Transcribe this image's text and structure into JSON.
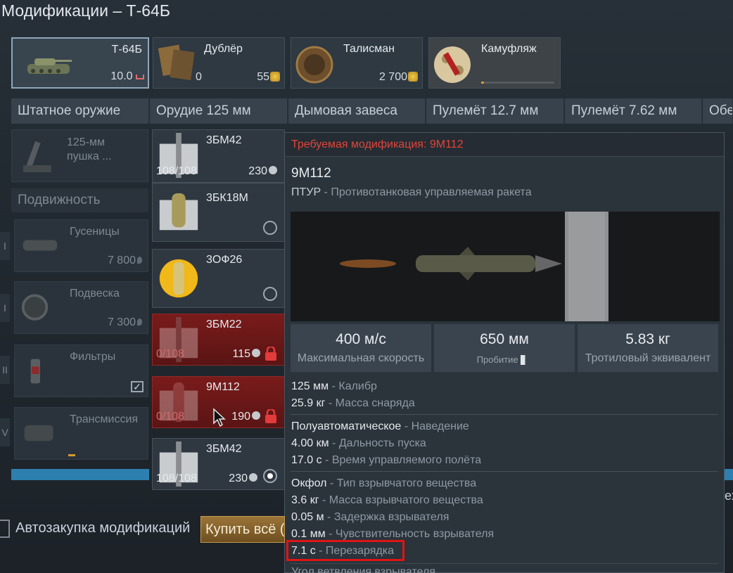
{
  "window": {
    "title": "Модификации – Т-64Б"
  },
  "slots": [
    {
      "name": "Т-64Б",
      "value": "10.0"
    },
    {
      "name": "Дублёр",
      "left_value": "0",
      "value": "55"
    },
    {
      "name": "Талисман",
      "value": "2 700"
    },
    {
      "name": "Камуфляж"
    }
  ],
  "tabs": [
    "Штатное оружие",
    "Орудие 125 мм",
    "Дымовая завеса",
    "Пулемёт 12.7 мм",
    "Пулемёт 7.62 мм",
    "Обе"
  ],
  "left_mods": {
    "gun_label": "125-мм пушка ...",
    "section": "Подвижность",
    "items": [
      {
        "label": "Гусеницы",
        "price": "7 800"
      },
      {
        "label": "Подвеска",
        "price": "7 300"
      },
      {
        "label": "Фильтры",
        "price": ""
      },
      {
        "label": "Трансмиссия",
        "price": ""
      }
    ],
    "roman": [
      "I",
      "I",
      "II",
      "V"
    ]
  },
  "ammo": [
    {
      "name": "3БМ42",
      "count": "108/108",
      "cost": "230"
    },
    {
      "name": "3БК18М"
    },
    {
      "name": "3ОФ26"
    },
    {
      "name": "3БМ22",
      "count": "0/108",
      "cost": "115"
    },
    {
      "name": "9М112",
      "count": "0/108",
      "cost": "190"
    },
    {
      "name": "3БМ42",
      "count": "108/108",
      "cost": "230"
    }
  ],
  "tooltip": {
    "required": "Требуемая модификация: 9М112",
    "title": "9М112",
    "subtitle_type": "ПТУР",
    "subtitle_desc": "Противотанковая управляемая ракета",
    "stats": [
      {
        "value": "400 м/с",
        "label": "Максимальная скорость"
      },
      {
        "value": "650 мм",
        "label": "Пробитие"
      },
      {
        "value": "5.83 кг",
        "label": "Тротиловый эквивалент"
      }
    ],
    "group1": [
      {
        "value": "125 мм",
        "label": "Калибр"
      },
      {
        "value": "25.9 кг",
        "label": "Масса снаряда"
      }
    ],
    "group2": [
      {
        "value": "Полуавтоматическое",
        "label": "Наведение"
      },
      {
        "value": "4.00 км",
        "label": "Дальность пуска"
      },
      {
        "value": "17.0 с",
        "label": "Время управляемого полёта"
      }
    ],
    "group3": [
      {
        "value": "Окфол",
        "label": "Тип взрывчатого вещества"
      },
      {
        "value": "3.6 кг",
        "label": "Масса взрывчатого вещества"
      },
      {
        "value": "0.05 м",
        "label": "Задержка взрывателя"
      },
      {
        "value": "0.1 мм",
        "label": "Чувствительность взрывателя"
      },
      {
        "value": "7.1 с",
        "label": "Перезарядка"
      }
    ],
    "cut_line": "Угол ветвления взрывателя..."
  },
  "bottom": {
    "auto_label": "Автозакупка модификаций",
    "buy_all": "Купить всё (",
    "side_char": "ex"
  },
  "colors": {
    "accent": "#2d7fb0",
    "warn": "#e0453a",
    "gold": "#c79b50"
  }
}
